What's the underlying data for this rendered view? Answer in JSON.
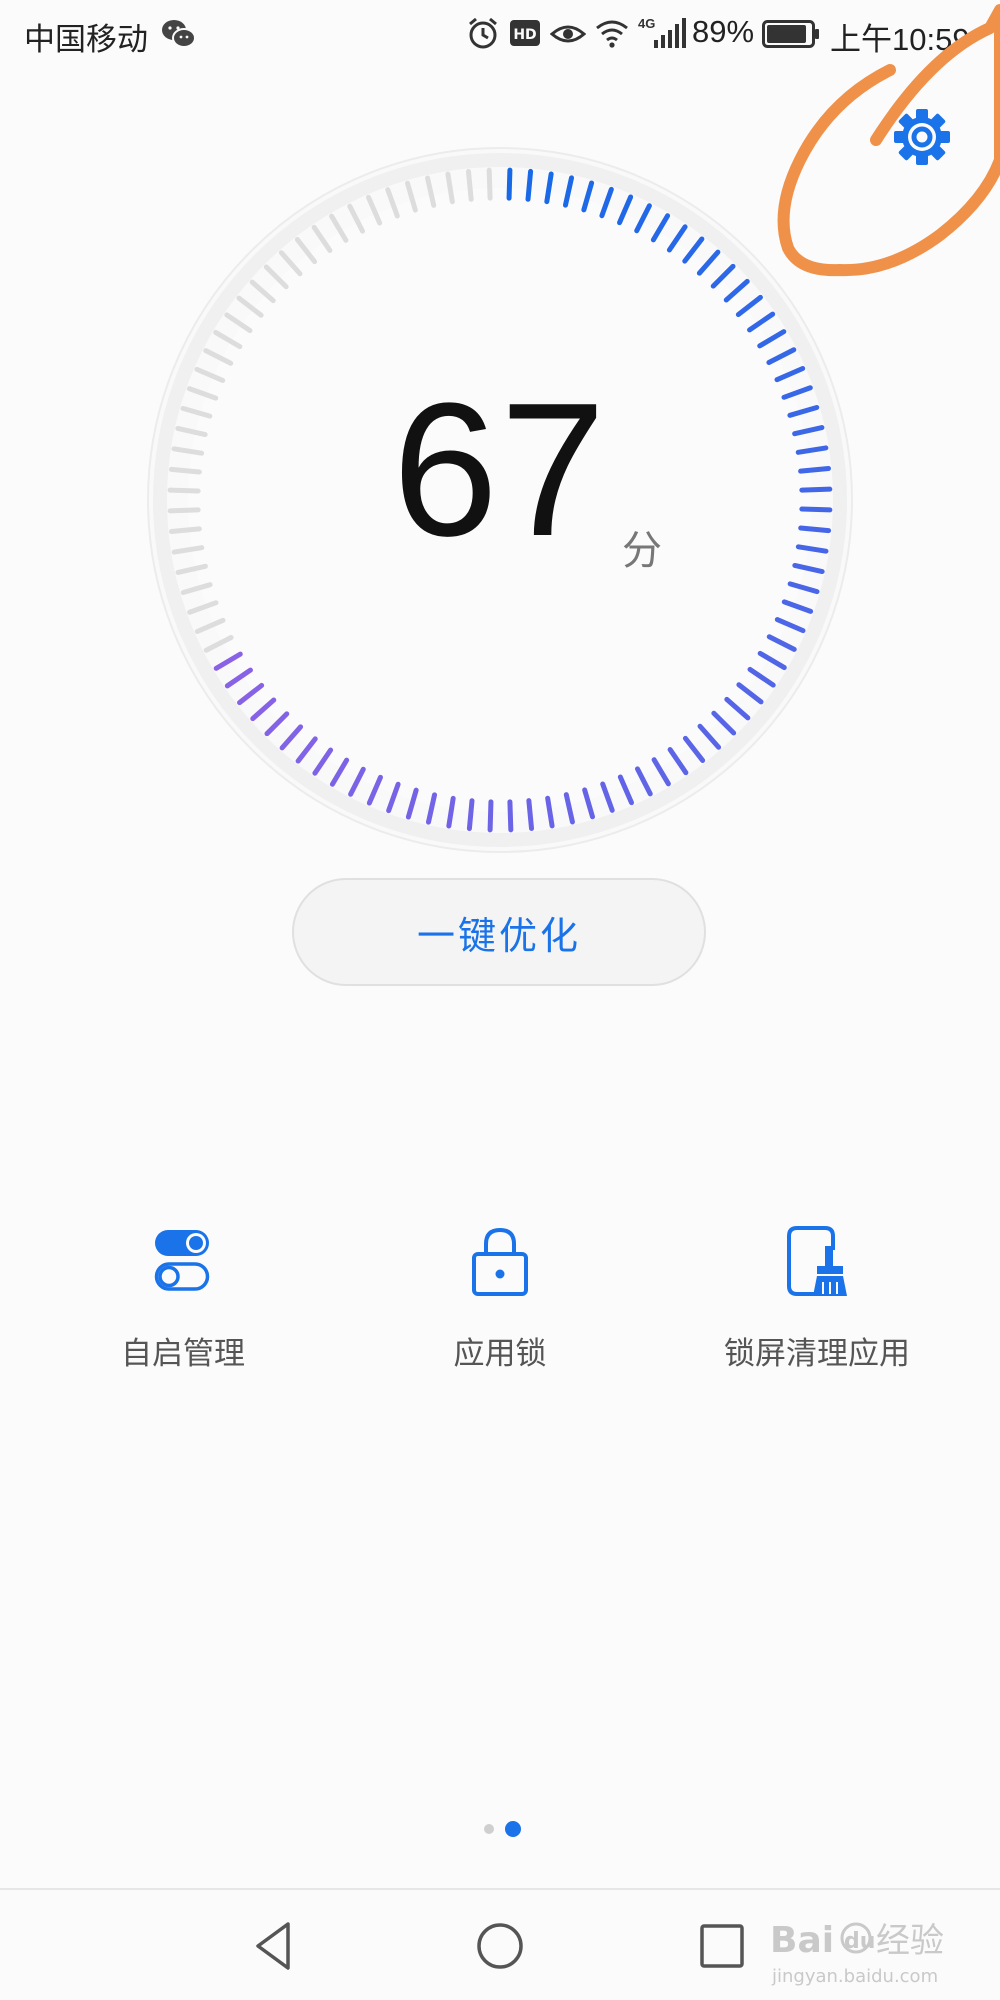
{
  "status_bar": {
    "carrier": "中国移动",
    "network": "4G",
    "battery": "89%",
    "time": "上午10:59",
    "icons": [
      "wechat-icon",
      "alarm-icon",
      "hd-icon",
      "eye-icon",
      "wifi-icon",
      "signal-icon",
      "battery-icon"
    ]
  },
  "settings": {
    "icon": "gear-icon"
  },
  "score": {
    "value": "67",
    "unit": "分",
    "fraction": 0.67
  },
  "optimize_button": {
    "label": "一键优化"
  },
  "features": [
    {
      "label": "自启管理",
      "icon": "toggle-switch-icon"
    },
    {
      "label": "应用锁",
      "icon": "lock-icon"
    },
    {
      "label": "锁屏清理应用",
      "icon": "phone-broom-icon"
    }
  ],
  "pager": {
    "pages": 2,
    "active": 2
  },
  "navbar": {
    "icons": [
      "back-icon",
      "home-icon",
      "recents-icon"
    ]
  },
  "colors": {
    "accent": "#1a73e8",
    "dial_blue": "#1769e8",
    "dial_purple": "#8a62e6",
    "dial_inactive": "#dddddd",
    "annotation": "#f0914a"
  },
  "watermark": {
    "text": "Baidu经验",
    "url": "jingyan.baidu.com"
  }
}
